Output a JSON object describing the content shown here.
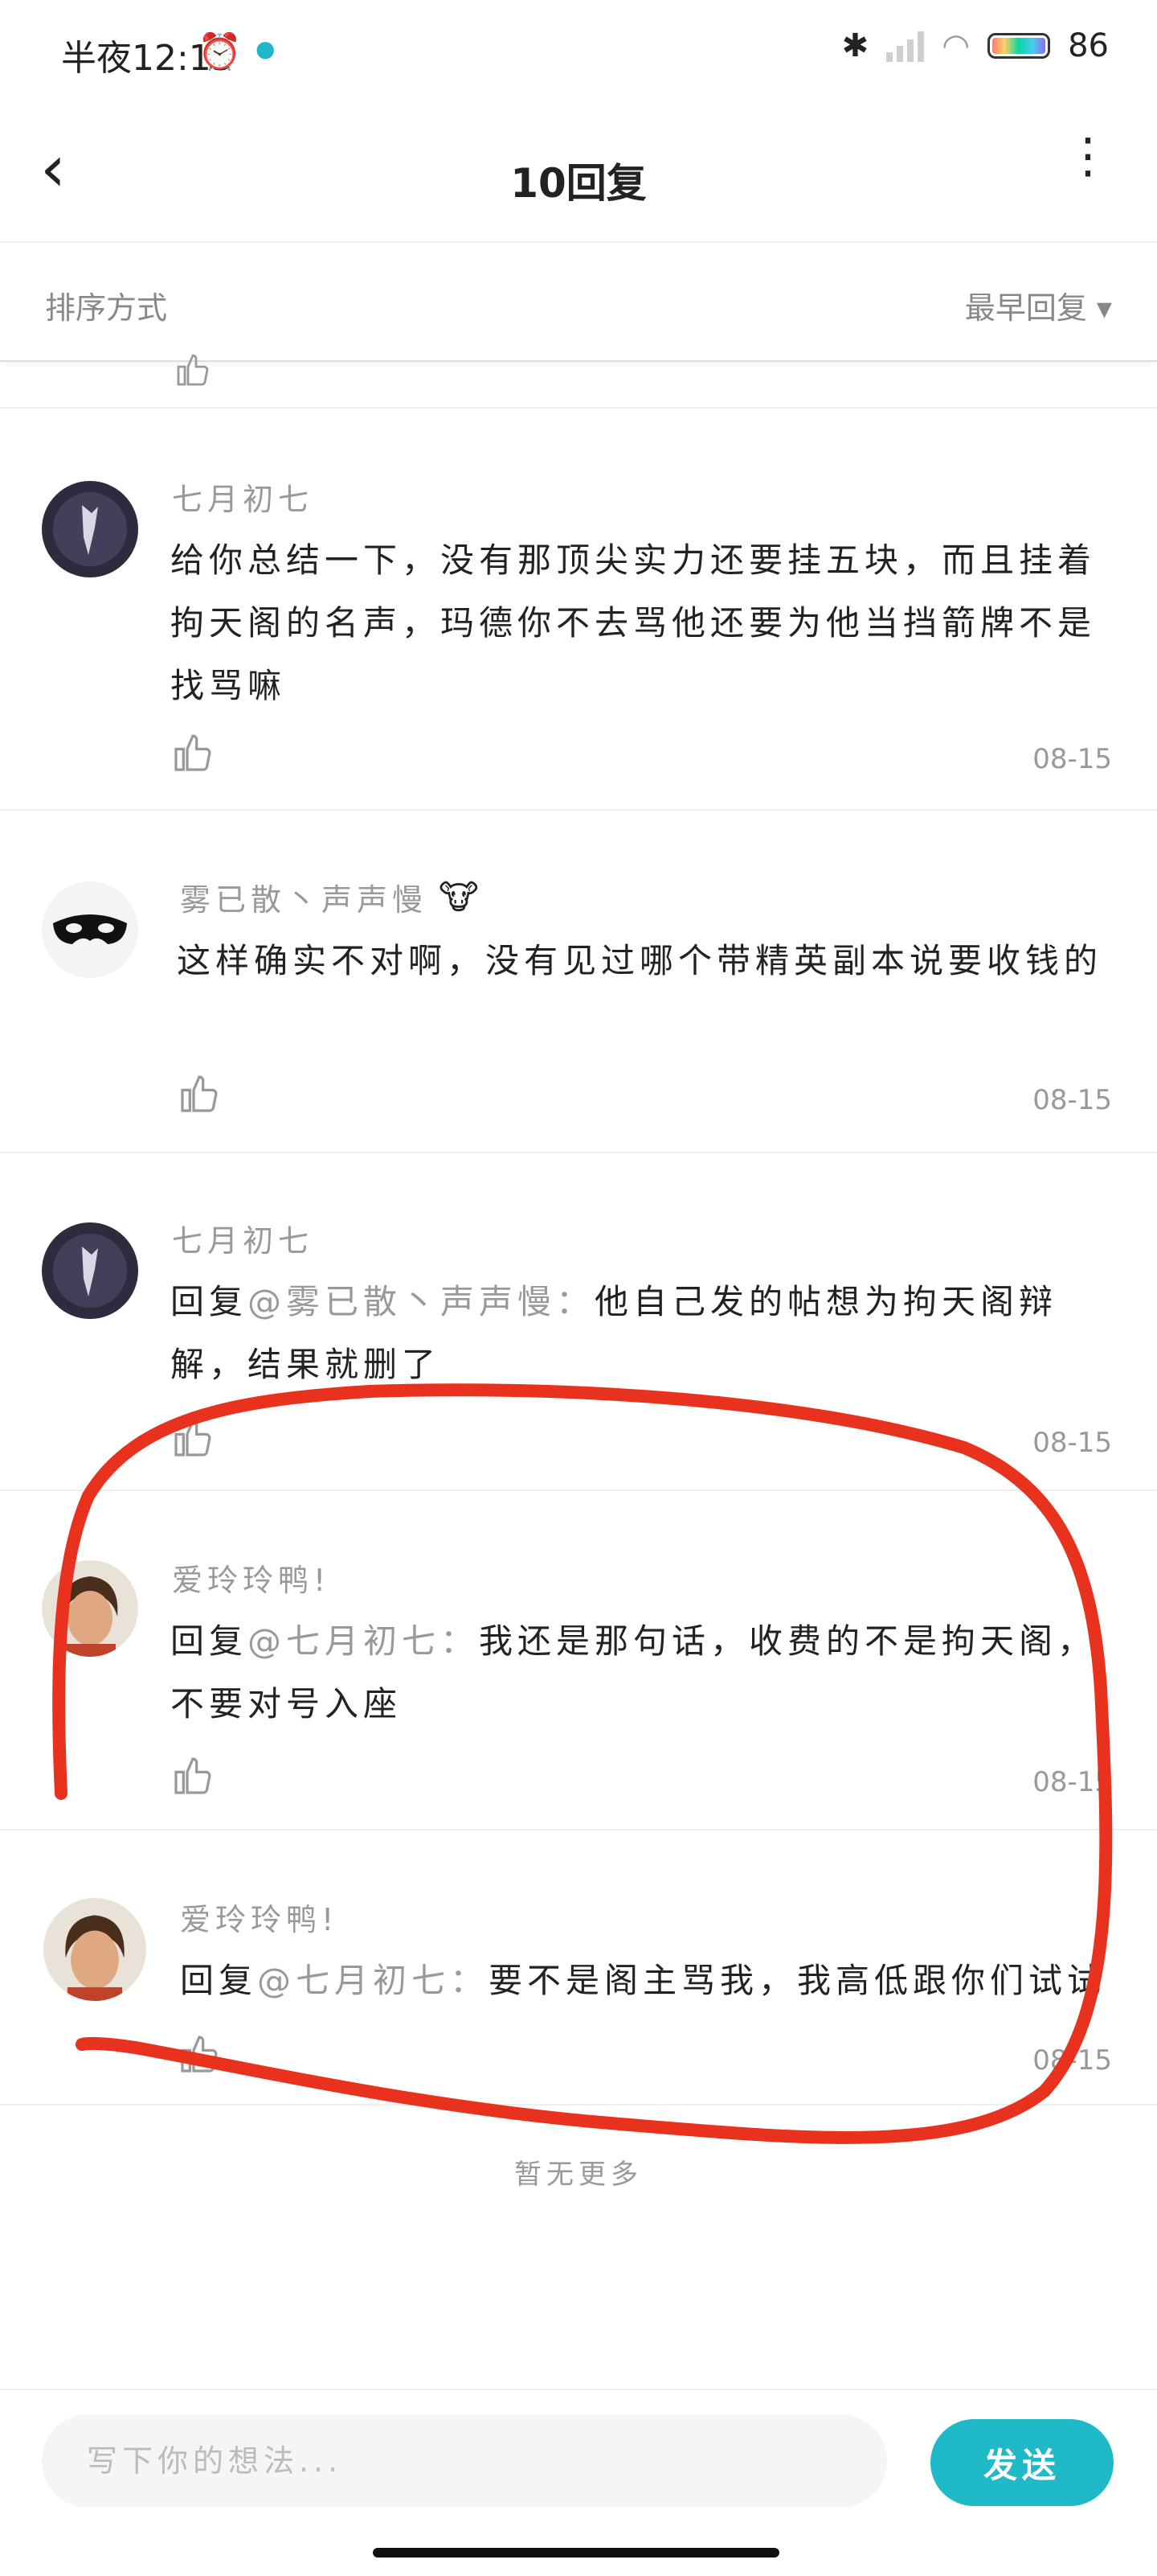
{
  "status_bar": {
    "time": "半夜12:15",
    "battery": "86"
  },
  "nav": {
    "title": "10回复"
  },
  "sort": {
    "label": "排序方式",
    "value": "最早回复 ▾"
  },
  "comments": [
    {
      "name": "七月初七",
      "text": "给你总结一下，没有那顶尖实力还要挂五块，而且挂着拘天阁的名声，玛德你不去骂他还要为他当挡箭牌不是找骂嘛",
      "date": "08-15"
    },
    {
      "name": "雾已散丶声声慢",
      "text": "这样确实不对啊，没有见过哪个带精英副本说要收钱的",
      "date": "08-15"
    },
    {
      "name": "七月初七",
      "reply_prefix": "回复",
      "mention": "@雾已散丶声声慢：",
      "text": "他自己发的帖想为拘天阁辩解，结果就删了",
      "date": "08-15"
    },
    {
      "name": "爱玲玲鸭!",
      "reply_prefix": "回复",
      "mention": "@七月初七：",
      "text": "我还是那句话，收费的不是拘天阁，不要对号入座",
      "date": "08-15"
    },
    {
      "name": "爱玲玲鸭!",
      "reply_prefix": "回复",
      "mention": "@七月初七：",
      "text": "要不是阁主骂我，我高低跟你们试试",
      "date": "08-15"
    }
  ],
  "footer_note": "暂无更多",
  "compose": {
    "placeholder": "写下你的想法...",
    "send_label": "发送"
  },
  "colors": {
    "accent": "#1fb9c8",
    "annotation": "#e8321e"
  }
}
